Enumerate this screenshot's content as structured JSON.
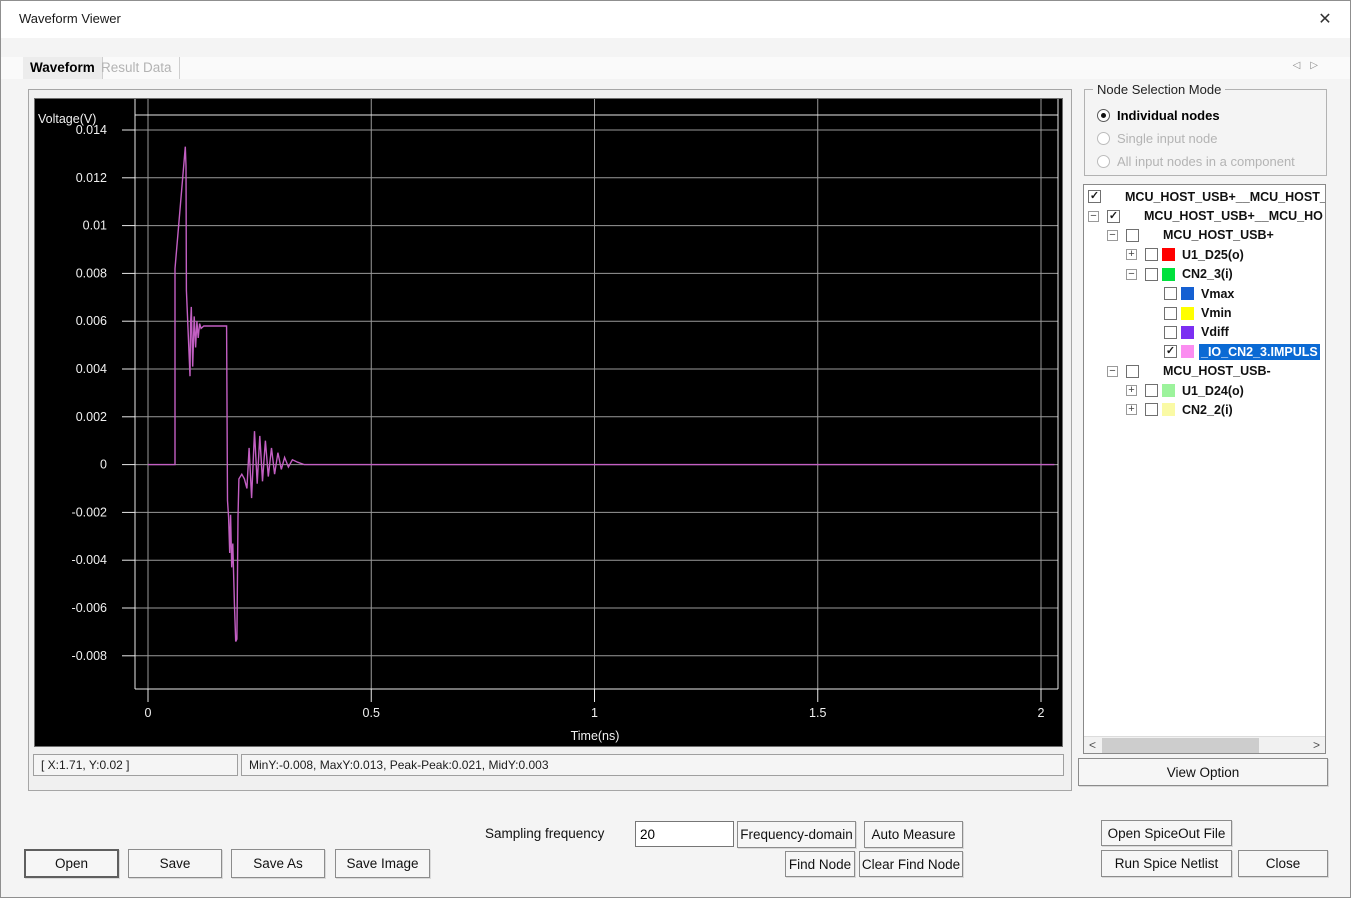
{
  "window": {
    "title": "Waveform Viewer",
    "close_glyph": "✕"
  },
  "tabs": {
    "active": "Waveform",
    "inactive": "Result Data",
    "nav_left": "◁",
    "nav_right": "▷"
  },
  "status": {
    "cursor": "[ X:1.71, Y:0.02 ]",
    "measure": "MinY:-0.008, MaxY:0.013, Peak-Peak:0.021, MidY:0.003"
  },
  "node_selection": {
    "title": "Node Selection Mode",
    "options": [
      {
        "label": "Individual nodes",
        "selected": true,
        "enabled": true
      },
      {
        "label": "Single input node",
        "selected": false,
        "enabled": false
      },
      {
        "label": "All input nodes in a component",
        "selected": false,
        "enabled": false
      }
    ]
  },
  "icons": {
    "check": "✓",
    "plus": "+",
    "minus": "−",
    "scroll_left": "<",
    "scroll_right": ">"
  },
  "tree": {
    "items": [
      {
        "level": 0,
        "expander": null,
        "checked": true,
        "swatch": null,
        "label": "MCU_HOST_USB+__MCU_HOST_",
        "selected": false
      },
      {
        "level": 1,
        "expander": "minus",
        "checked": true,
        "swatch": null,
        "label": "MCU_HOST_USB+__MCU_HO",
        "selected": false
      },
      {
        "level": 2,
        "expander": "minus",
        "checked": false,
        "swatch": null,
        "label": "MCU_HOST_USB+",
        "selected": false
      },
      {
        "level": 3,
        "expander": "plus",
        "checked": false,
        "swatch": "#ff0000",
        "label": "U1_D25(o)",
        "selected": false
      },
      {
        "level": 3,
        "expander": "minus",
        "checked": false,
        "swatch": "#00e13d",
        "label": "CN2_3(i)",
        "selected": false
      },
      {
        "level": 4,
        "expander": null,
        "checked": false,
        "swatch": "#1560d2",
        "label": "Vmax",
        "selected": false
      },
      {
        "level": 4,
        "expander": null,
        "checked": false,
        "swatch": "#ffff00",
        "label": "Vmin",
        "selected": false
      },
      {
        "level": 4,
        "expander": null,
        "checked": false,
        "swatch": "#7b2ff2",
        "label": "Vdiff",
        "selected": false
      },
      {
        "level": 4,
        "expander": null,
        "checked": true,
        "swatch": "#fb8df0",
        "label": "_IO_CN2_3.IMPULS",
        "selected": true
      },
      {
        "level": 2,
        "expander": "minus",
        "checked": false,
        "swatch": null,
        "label": "MCU_HOST_USB-",
        "selected": false
      },
      {
        "level": 3,
        "expander": "plus",
        "checked": false,
        "swatch": "#9cf39c",
        "label": "U1_D24(o)",
        "selected": false
      },
      {
        "level": 3,
        "expander": "plus",
        "checked": false,
        "swatch": "#fafaa5",
        "label": "CN2_2(i)",
        "selected": false
      }
    ]
  },
  "buttons": {
    "view_option": "View Option",
    "open": "Open",
    "save": "Save",
    "save_as": "Save As",
    "save_image": "Save Image",
    "frequency_domain": "Frequency-domain",
    "auto_measure": "Auto Measure",
    "find_node": "Find Node",
    "clear_find_node": "Clear Find Node",
    "open_spiceout": "Open SpiceOut File",
    "run_spice": "Run Spice Netlist",
    "close": "Close"
  },
  "sampling": {
    "label": "Sampling frequency",
    "value": "20"
  },
  "chart_data": {
    "type": "line",
    "title": "",
    "xlabel": "Time(ns)",
    "ylabel": "Voltage(V)",
    "xlim": [
      -0.03,
      2.04
    ],
    "ylim": [
      -0.0094,
      0.0146
    ],
    "grid": true,
    "background": "#000000",
    "grid_color": "#9a9a9a",
    "frame_color": "#e9e9e9",
    "x_ticks": [
      {
        "v": 0,
        "label": "0"
      },
      {
        "v": 0.5,
        "label": "0.5"
      },
      {
        "v": 1,
        "label": "1"
      },
      {
        "v": 1.5,
        "label": "1.5"
      },
      {
        "v": 2,
        "label": "2"
      }
    ],
    "y_ticks": [
      {
        "v": 0.014,
        "label": "0.014"
      },
      {
        "v": 0.012,
        "label": "0.012"
      },
      {
        "v": 0.01,
        "label": "0.01"
      },
      {
        "v": 0.008,
        "label": "0.008"
      },
      {
        "v": 0.006,
        "label": "0.006"
      },
      {
        "v": 0.004,
        "label": "0.004"
      },
      {
        "v": 0.002,
        "label": "0.002"
      },
      {
        "v": 0,
        "label": "0"
      },
      {
        "v": -0.002,
        "label": "-0.002"
      },
      {
        "v": -0.004,
        "label": "-0.004"
      },
      {
        "v": -0.006,
        "label": "-0.006"
      },
      {
        "v": -0.008,
        "label": "-0.008"
      }
    ],
    "series": [
      {
        "name": "_IO_CN2_3.IMPULS",
        "color": "#c35fc3",
        "points": [
          [
            0,
            0
          ],
          [
            0.0605,
            0
          ],
          [
            0.0605,
            0.0082
          ],
          [
            0.08,
            0.0125
          ],
          [
            0.0835,
            0.0133
          ],
          [
            0.085,
            0.0125
          ],
          [
            0.086,
            0.0073
          ],
          [
            0.094,
            0.0037
          ],
          [
            0.0955,
            0.0059
          ],
          [
            0.097,
            0.0066
          ],
          [
            0.1,
            0.0041
          ],
          [
            0.1035,
            0.0062
          ],
          [
            0.1065,
            0.0049
          ],
          [
            0.1095,
            0.006
          ],
          [
            0.1125,
            0.0053
          ],
          [
            0.1155,
            0.0059
          ],
          [
            0.119,
            0.0057
          ],
          [
            0.125,
            0.0058
          ],
          [
            0.176,
            0.0058
          ],
          [
            0.1775,
            0.0
          ],
          [
            0.178,
            -0.0015
          ],
          [
            0.1805,
            -0.0022
          ],
          [
            0.183,
            -0.0037
          ],
          [
            0.185,
            -0.0021
          ],
          [
            0.1875,
            -0.0043
          ],
          [
            0.19,
            -0.0033
          ],
          [
            0.1935,
            -0.0058
          ],
          [
            0.1965,
            -0.0074
          ],
          [
            0.199,
            -0.0073
          ],
          [
            0.2015,
            -0.0022
          ],
          [
            0.2035,
            -0.0006
          ],
          [
            0.21,
            -0.0004
          ],
          [
            0.216,
            -0.0006
          ],
          [
            0.2215,
            -0.001
          ],
          [
            0.2265,
            0.0007
          ],
          [
            0.232,
            -0.0014
          ],
          [
            0.2385,
            0.0014
          ],
          [
            0.2445,
            -0.0008
          ],
          [
            0.2505,
            0.0012
          ],
          [
            0.2565,
            -0.0007
          ],
          [
            0.263,
            0.001
          ],
          [
            0.2695,
            -0.0005
          ],
          [
            0.2765,
            0.0007
          ],
          [
            0.2835,
            -0.0004
          ],
          [
            0.291,
            0.0005
          ],
          [
            0.2985,
            -0.0002
          ],
          [
            0.306,
            0.0003
          ],
          [
            0.3145,
            -0.0001
          ],
          [
            0.3235,
            0.0002
          ],
          [
            0.335,
            0.0001
          ],
          [
            0.35,
            0
          ],
          [
            2.03,
            0
          ]
        ]
      }
    ]
  }
}
